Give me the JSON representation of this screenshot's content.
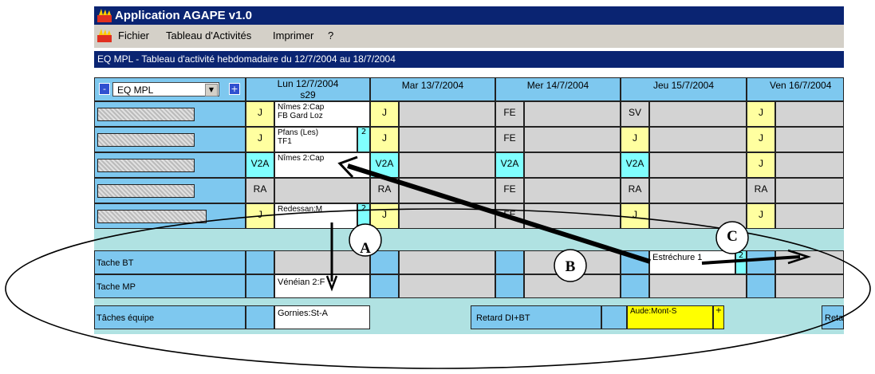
{
  "app": {
    "title": "Application AGAPE v1.0",
    "logo_icon": "agape-logo-icon"
  },
  "menu": {
    "items": [
      "Fichier",
      "Tableau d'Activités",
      "Imprimer",
      "?"
    ]
  },
  "subtitle": "EQ MPL - Tableau d'activité hebdomadaire du 12/7/2004 au 18/7/2004",
  "team_select": {
    "value": "EQ MPL",
    "prev_label": "-",
    "next_label": "+"
  },
  "days": [
    {
      "label": "Lun 12/7/2004",
      "week": "s29"
    },
    {
      "label": "Mar 13/7/2004"
    },
    {
      "label": "Mer 14/7/2004"
    },
    {
      "label": "Jeu 15/7/2004"
    },
    {
      "label": "Ven 16/7/2004"
    }
  ],
  "rows": [
    {
      "codes": [
        "J",
        "J",
        "FE",
        "SV",
        "J"
      ],
      "note": [
        "Nîmes 2:Cap",
        "FB Gard Loz"
      ],
      "badge": ""
    },
    {
      "codes": [
        "J",
        "J",
        "FE",
        "J",
        "J"
      ],
      "note": [
        "Pfans (Les)",
        "TF1"
      ],
      "badge": "2"
    },
    {
      "codes": [
        "V2A",
        "V2A",
        "V2A",
        "V2A",
        "J"
      ],
      "note": [
        "Nîmes 2:Cap",
        ""
      ],
      "badge": ""
    },
    {
      "codes": [
        "RA",
        "RA",
        "FE",
        "RA",
        "RA"
      ],
      "note": [
        "",
        ""
      ],
      "badge": ""
    },
    {
      "codes": [
        "J",
        "J",
        "FE",
        "J",
        "J"
      ],
      "note": [
        "Redessan:M",
        ""
      ],
      "badge": "2"
    }
  ],
  "tasks": {
    "bt_label": "Tache BT",
    "mp_label": "Tache MP",
    "team_label": "Tâches équipe",
    "bt_note": "Estréchure 1",
    "bt_badge": "2",
    "mp_note": "Vénéian 2:F",
    "team_note": "Gornies:St-A",
    "retard_label": "Retard DI+BT",
    "aude_label": "Aude:Mont-S",
    "aude_badge": "+",
    "retard_cut": "Retar"
  },
  "callouts": [
    "A",
    "B",
    "C"
  ],
  "colors": {
    "titlebar": "#0a2472",
    "blue": "#7ec8ef",
    "yellow": "#ffffa0",
    "cyan": "#80ffff",
    "grey": "#d3d3d3",
    "teal": "#b0e2e2"
  }
}
